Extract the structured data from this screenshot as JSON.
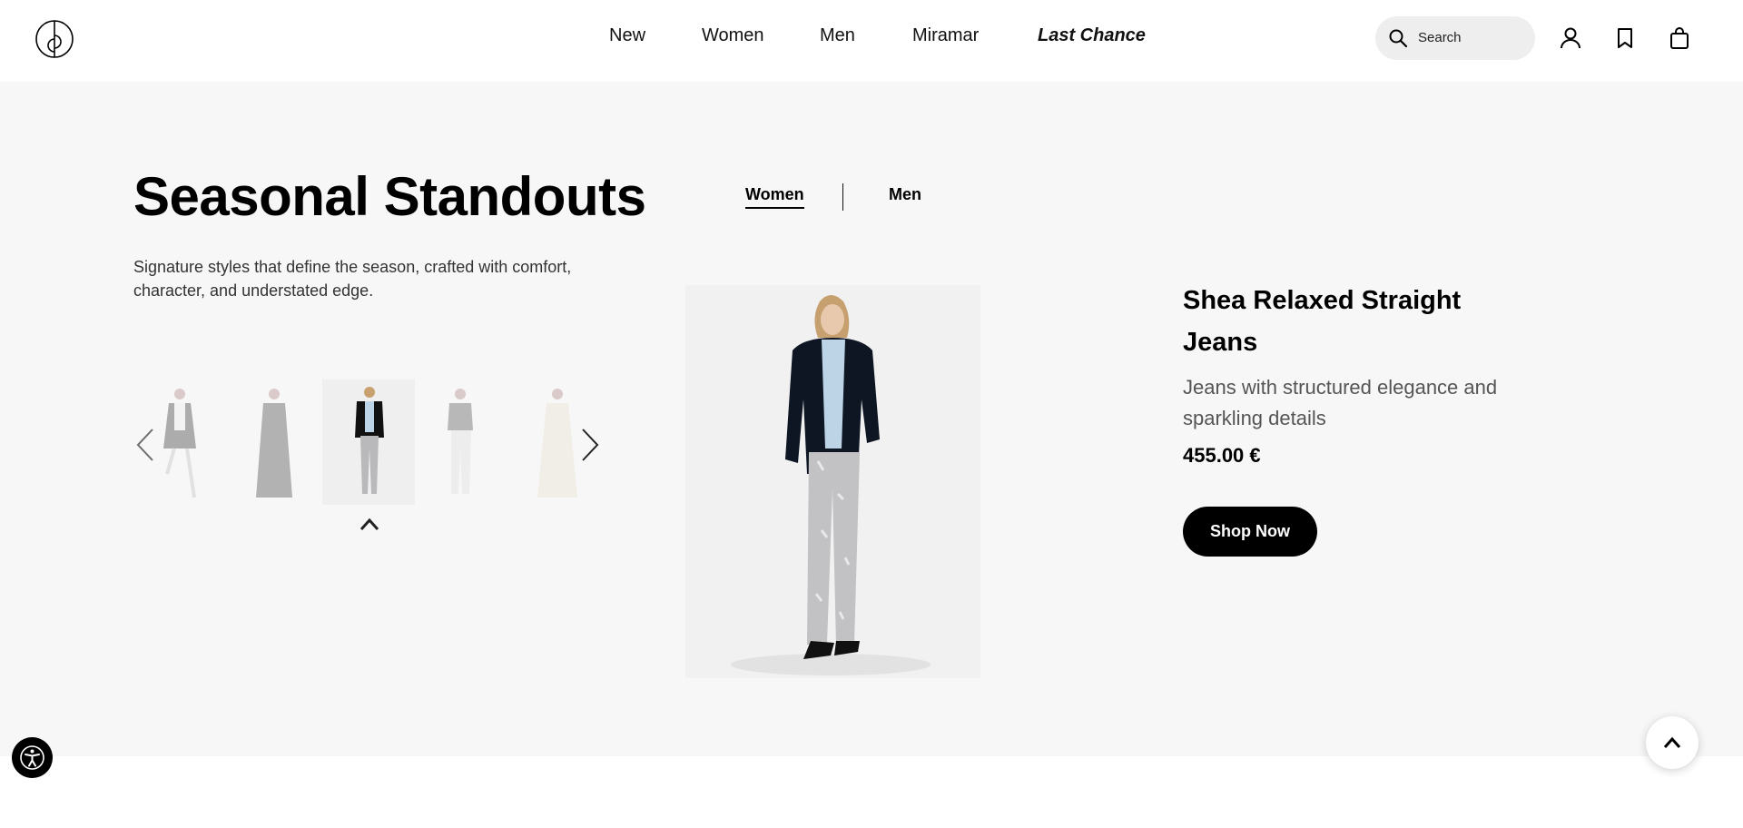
{
  "header": {
    "logo_icon": "brand-logo-icon",
    "nav": [
      {
        "label": "New"
      },
      {
        "label": "Women"
      },
      {
        "label": "Men"
      },
      {
        "label": "Miramar"
      },
      {
        "label": "Last Chance"
      }
    ],
    "search": {
      "placeholder": "Search",
      "icon": "search-icon"
    },
    "icons": [
      "account-icon",
      "bookmark-icon",
      "bag-icon"
    ]
  },
  "section": {
    "title": "Seasonal Standouts",
    "subtitle": "Signature styles that define the season, crafted with comfort, character, and understated edge.",
    "tabs": [
      {
        "label": "Women",
        "active": true
      },
      {
        "label": "Men",
        "active": false
      }
    ],
    "carousel": {
      "selected_index": 2,
      "thumb_count": 5
    }
  },
  "product": {
    "name": "Shea Relaxed Straight Jeans",
    "description": "Jeans with structured elegance and sparkling details",
    "price": "455.00 €",
    "cta": "Shop Now"
  },
  "colors": {
    "background": "#f7f7f7",
    "accent": "#000000",
    "text_muted": "#555555"
  }
}
